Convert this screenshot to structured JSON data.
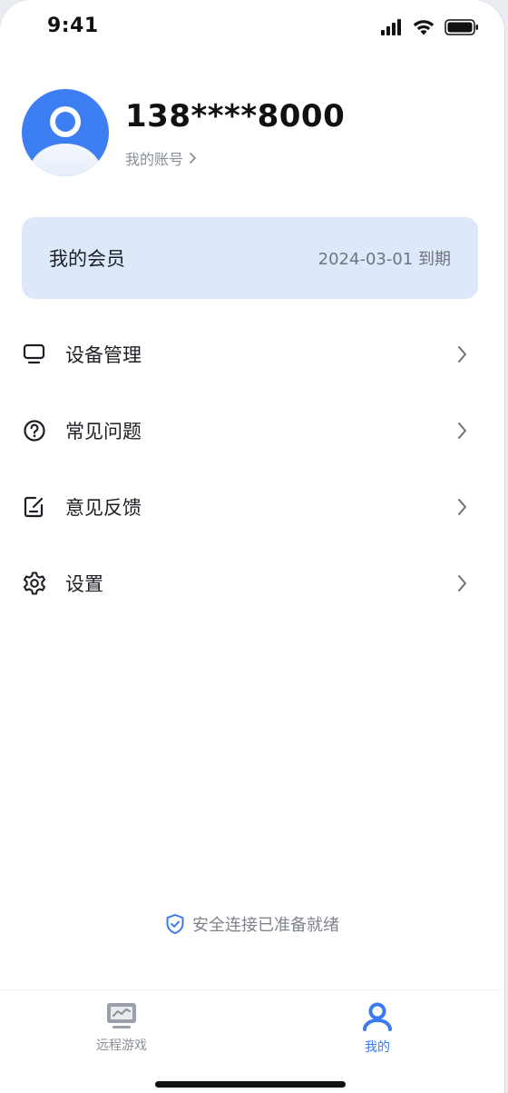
{
  "status_bar": {
    "time": "9:41",
    "icons": [
      "cellular-signal-icon",
      "wifi-icon",
      "battery-icon"
    ]
  },
  "profile": {
    "phone_number": "138****8000",
    "account_link": "我的账号"
  },
  "membership": {
    "title": "我的会员",
    "expiry": "2024-03-01 到期"
  },
  "menu": {
    "items": [
      {
        "label": "设备管理",
        "icon": "monitor-icon"
      },
      {
        "label": "常见问题",
        "icon": "question-circle-icon"
      },
      {
        "label": "意见反馈",
        "icon": "feedback-edit-icon"
      },
      {
        "label": "设置",
        "icon": "gear-icon"
      }
    ]
  },
  "footer": {
    "secure_note": "安全连接已准备就绪",
    "icon": "shield-check-icon"
  },
  "tab_bar": {
    "tabs": [
      {
        "label": "远程游戏",
        "icon": "remote-game-monitor-icon",
        "active": false
      },
      {
        "label": "我的",
        "icon": "user-icon",
        "active": true
      }
    ]
  },
  "colors": {
    "accent": "#3a7bf0",
    "member_card_bg": "#dde8fb",
    "text_primary": "#1c1f24",
    "text_secondary": "#8a8f98"
  }
}
